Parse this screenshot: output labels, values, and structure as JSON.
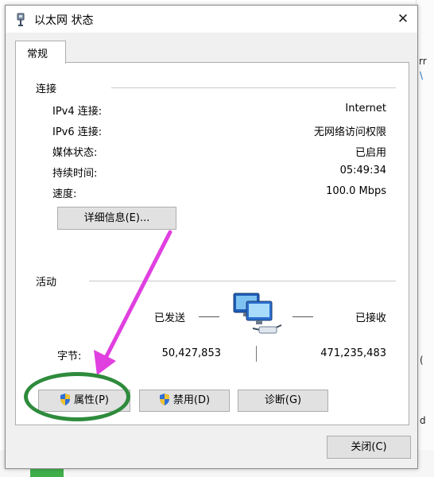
{
  "window": {
    "title": "以太网 状态",
    "close_glyph": "✕"
  },
  "tabs": [
    {
      "label": "常规"
    }
  ],
  "connection": {
    "section_title": "连接",
    "rows": [
      {
        "label": "IPv4 连接:",
        "value": "Internet"
      },
      {
        "label": "IPv6 连接:",
        "value": "无网络访问权限"
      },
      {
        "label": "媒体状态:",
        "value": "已启用"
      },
      {
        "label": "持续时间:",
        "value": "05:49:34"
      },
      {
        "label": "速度:",
        "value": "100.0 Mbps"
      }
    ],
    "details_button": "详细信息(E)..."
  },
  "activity": {
    "section_title": "活动",
    "sent_label": "已发送",
    "received_label": "已接收",
    "bytes_label": "字节:",
    "bytes_sent": "50,427,853",
    "bytes_received": "471,235,483",
    "network_icon": "network-computers-icon"
  },
  "buttons": {
    "properties": "属性(P)",
    "disable": "禁用(D)",
    "diagnose": "诊断(G)",
    "close": "关闭(C)"
  },
  "background": {
    "snippet_1": "rr",
    "snippet_2": "\\",
    "snippet_3": "(",
    "snippet_4": "d"
  },
  "colors": {
    "arrow": "#e040e0",
    "highlight_ellipse": "#2e8b3c",
    "shield_blue": "#2f6fd6",
    "shield_yellow": "#f2c230"
  }
}
